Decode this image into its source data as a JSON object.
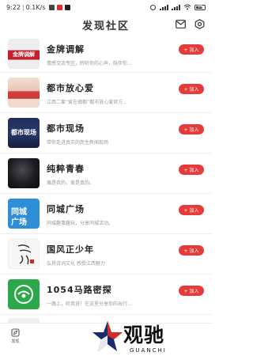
{
  "status_bar": {
    "time": "9:22",
    "speed": "0.1K/s",
    "battery": "99"
  },
  "header": {
    "title": "发现社区"
  },
  "join_label": "+ 加入",
  "communities": [
    {
      "name": "金牌调解",
      "desc": "情感交流专区，聆听你的心声，陪伴你..."
    },
    {
      "name": "都市放心爱",
      "desc": "江西二套“爱在赣都”都市放心爱官方..."
    },
    {
      "name": "都市现场",
      "desc": "带你走进真实的民生新闻现场"
    },
    {
      "name": "纯粹青春",
      "desc": "痛是我的，爱是真的。"
    },
    {
      "name": "同城广场",
      "desc": "同城趣事趣玩，分享同城活动。"
    },
    {
      "name": "国风正少年",
      "desc": "弘扬诗词文化 感受江西魅力"
    },
    {
      "name": "1054马路密探",
      "desc": "一路上，听我说！在这里分享你的出行..."
    }
  ],
  "thumb_texts": {
    "jinpai": "金牌调解",
    "dushi_xianchang": "都市现场",
    "tongcheng_line1": "同城",
    "tongcheng_line2": "广场"
  },
  "tabbar": {
    "discover_label": "发现"
  },
  "watermark": {
    "cn": "观驰",
    "en": "GUANCHI"
  },
  "colors": {
    "accent": "#e63b3b"
  }
}
